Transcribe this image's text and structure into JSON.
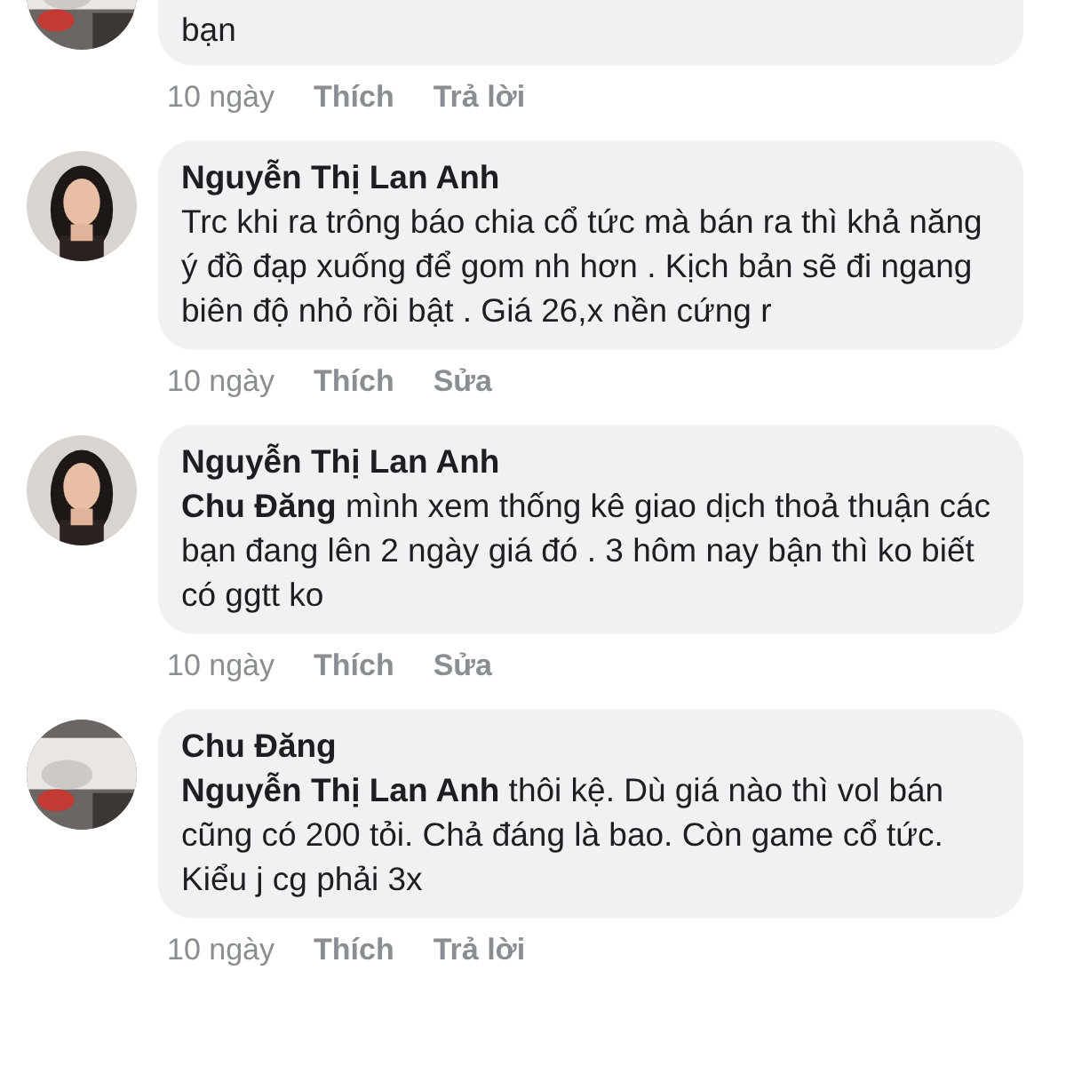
{
  "comments": [
    {
      "body": "bạn",
      "time": "10 ngày",
      "like": "Thích",
      "action": "Trả lời"
    },
    {
      "author": "Nguyễn Thị Lan Anh",
      "body": "Trc khi ra trông báo chia cổ tức mà bán ra thì khả năng ý đồ đạp xuống để gom nh hơn . Kịch bản sẽ đi ngang biên độ nhỏ rồi bật . Giá 26,x nền cứng r",
      "time": "10 ngày",
      "like": "Thích",
      "action": "Sửa"
    },
    {
      "author": "Nguyễn Thị Lan Anh",
      "body": "**Chu Đăng**  mình xem thống kê giao dịch thoả thuận các bạn đang lên 2 ngày giá đó . 3 hôm nay bận thì ko biết có ggtt ko",
      "time": "10 ngày",
      "like": "Thích",
      "action": "Sửa"
    },
    {
      "author": "Chu Đăng",
      "body": "**Nguyễn Thị Lan Anh**  thôi kệ. Dù giá nào thì vol bán cũng có 200 tỏi. Chả đáng là bao. Còn game cổ tức. Kiểu j cg phải 3x",
      "time": "10 ngày",
      "like": "Thích",
      "action": "Trả lời"
    }
  ]
}
